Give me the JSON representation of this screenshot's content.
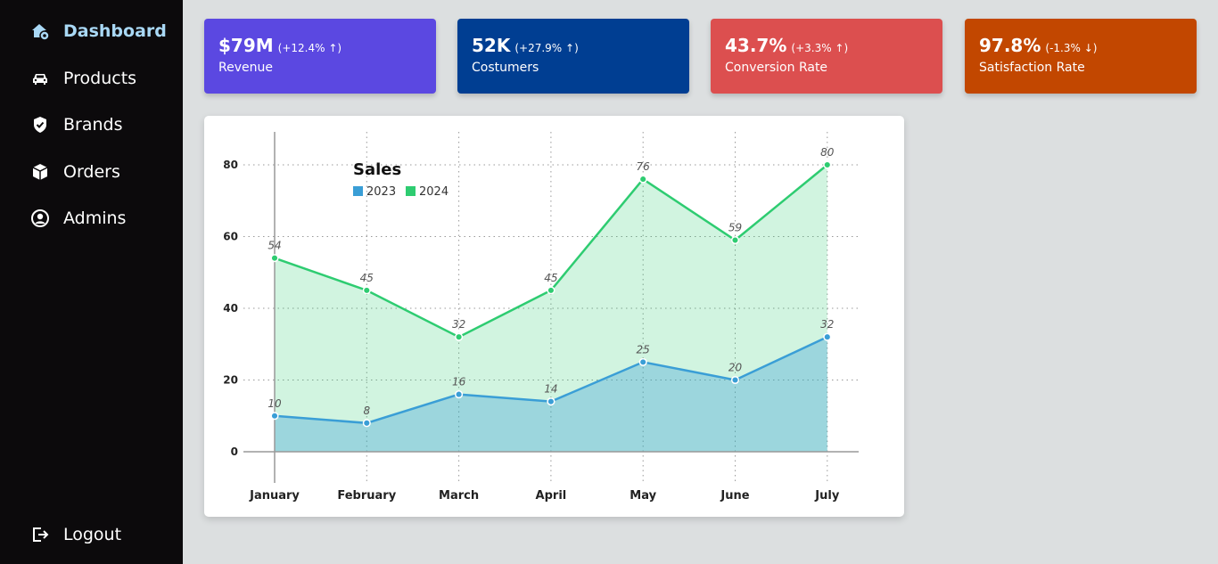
{
  "sidebar": {
    "items": [
      {
        "label": "Dashboard",
        "icon": "house-gear-icon",
        "active": true
      },
      {
        "label": "Products",
        "icon": "car-icon",
        "active": false
      },
      {
        "label": "Brands",
        "icon": "shield-check-icon",
        "active": false
      },
      {
        "label": "Orders",
        "icon": "box-icon",
        "active": false
      },
      {
        "label": "Admins",
        "icon": "user-circle-icon",
        "active": false
      }
    ],
    "logout": {
      "label": "Logout",
      "icon": "logout-icon"
    }
  },
  "cards": [
    {
      "value": "$79M",
      "change": "(+12.4% ↑)",
      "title": "Revenue",
      "color": "#5b48e1"
    },
    {
      "value": "52K",
      "change": "(+27.9% ↑)",
      "title": "Costumers",
      "color": "#003e92"
    },
    {
      "value": "43.7%",
      "change": "(+3.3% ↑)",
      "title": "Conversion Rate",
      "color": "#dc4f4f"
    },
    {
      "value": "97.8%",
      "change": "(-1.3% ↓)",
      "title": "Satisfaction Rate",
      "color": "#c24700"
    }
  ],
  "chart_data": {
    "type": "area",
    "title": "Sales",
    "categories": [
      "January",
      "February",
      "March",
      "April",
      "May",
      "June",
      "July"
    ],
    "series": [
      {
        "name": "2023",
        "values": [
          10,
          8,
          16,
          14,
          25,
          20,
          32
        ],
        "color": "#3a9ed6"
      },
      {
        "name": "2024",
        "values": [
          54,
          45,
          32,
          45,
          76,
          59,
          80
        ],
        "color": "#2ecc71"
      }
    ],
    "ylim": [
      0,
      80
    ],
    "yticks": [
      0,
      20,
      40,
      60,
      80
    ],
    "xlabel": "",
    "ylabel": "",
    "grid": true,
    "legend": "top-left"
  }
}
